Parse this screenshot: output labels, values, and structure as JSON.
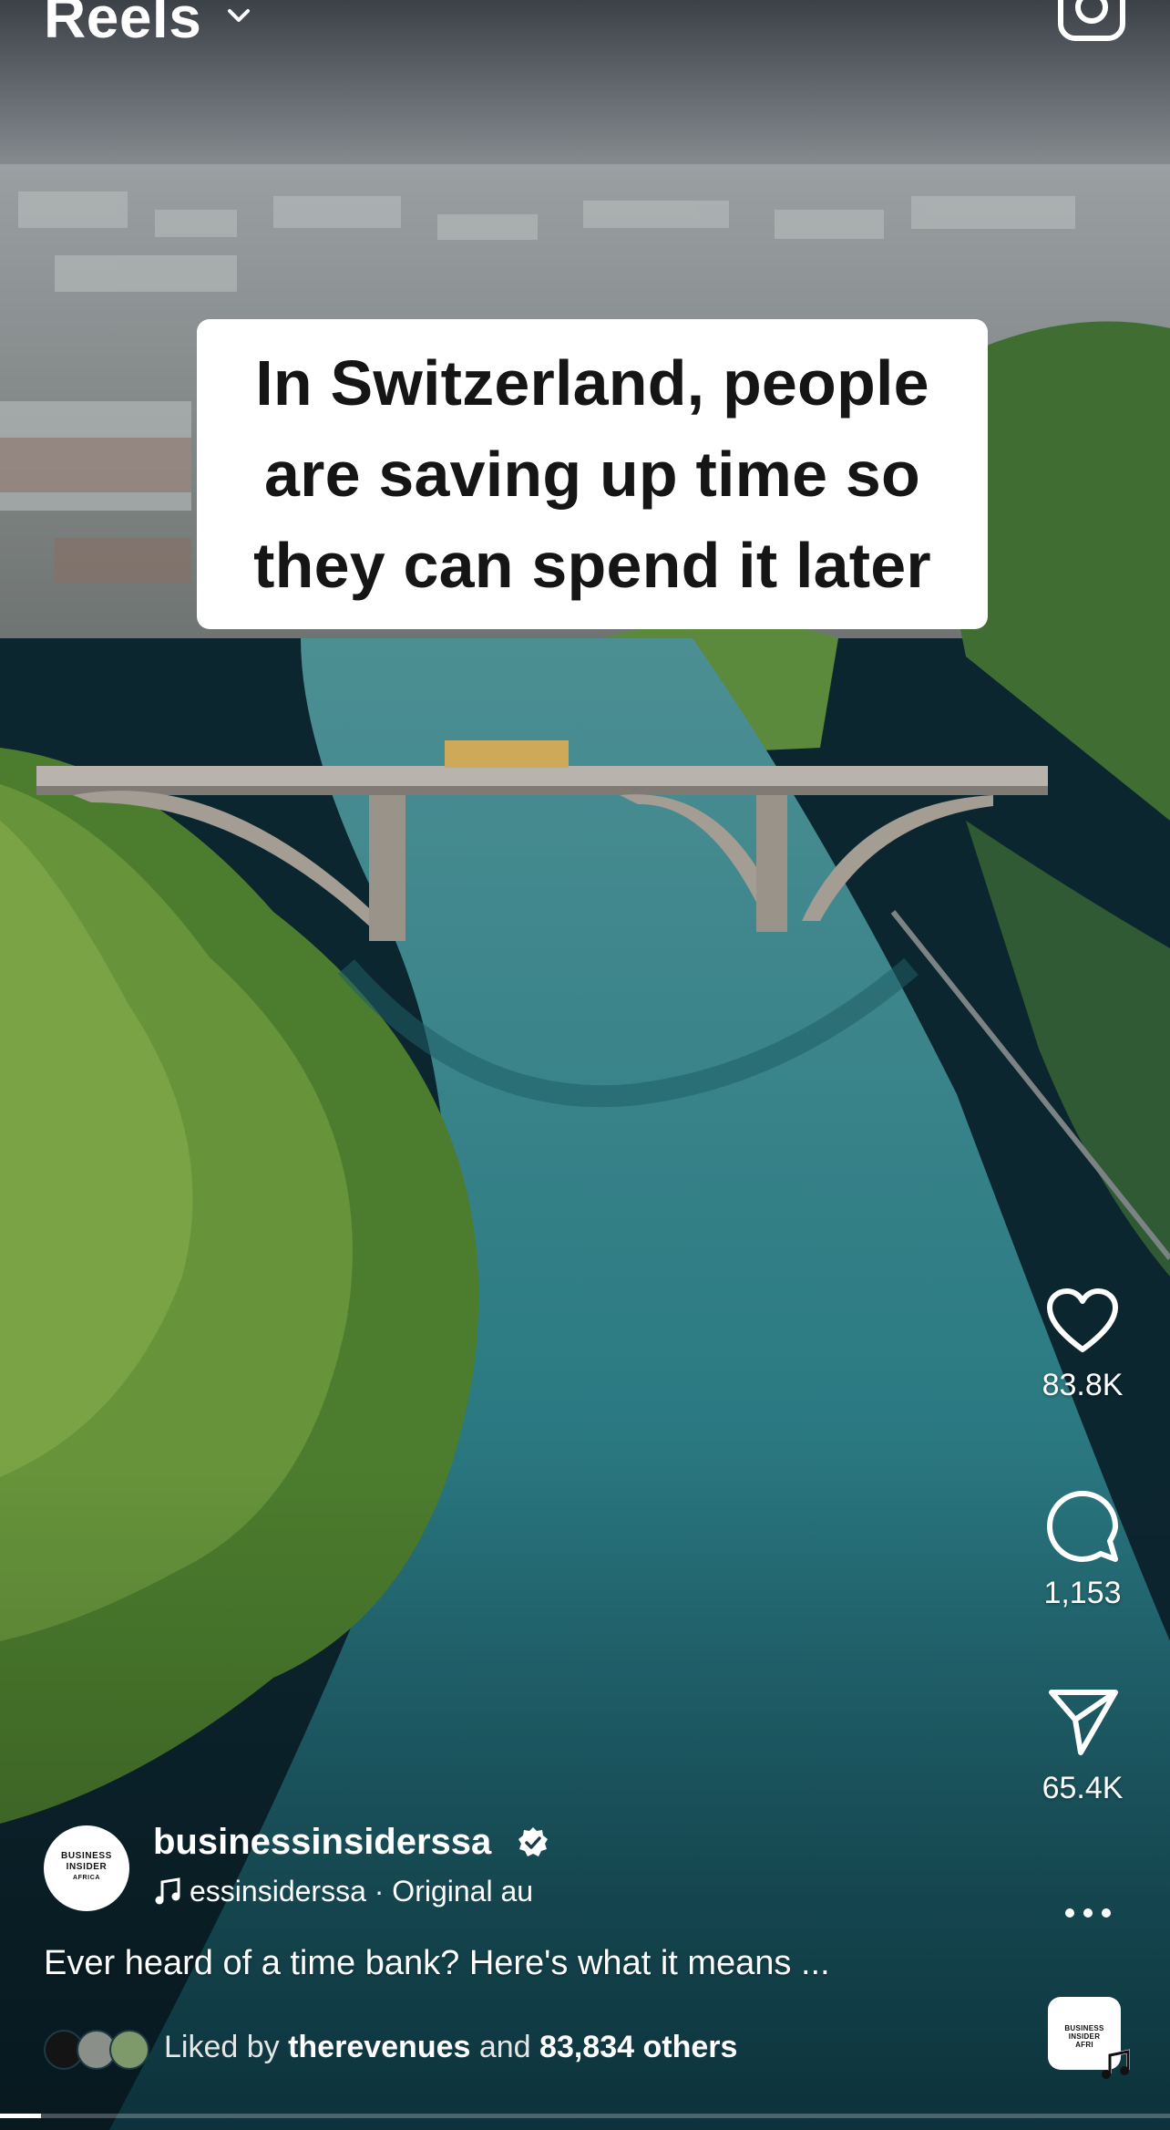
{
  "header": {
    "title": "Reels",
    "title_dropdown_icon": "chevron-down-icon",
    "camera_icon": "camera-icon"
  },
  "video": {
    "caption_lines": [
      "In Switzerland, people",
      "are saving up time so",
      "they can spend it later"
    ],
    "progress_fraction": 0.035
  },
  "actions": {
    "like": {
      "icon": "heart-icon",
      "count": "83.8K"
    },
    "comment": {
      "icon": "comment-bubble-icon",
      "count": "1,153"
    },
    "share": {
      "icon": "paper-plane-icon",
      "count": "65.4K"
    },
    "more_icon": "more-dots-icon"
  },
  "author": {
    "username": "businessinsiderssa",
    "verified_icon": "verified-badge-icon",
    "avatar_text": [
      "BUSINESS",
      "INSIDER",
      "AFRICA"
    ],
    "audio_text": "essinsiderssa · Original au"
  },
  "post": {
    "description": "Ever heard of a time bank? Here's what it means ...",
    "likes_prefix": "Liked by ",
    "likes_user": "therevenues",
    "likes_middle": " and ",
    "likes_others": "83,834 others"
  },
  "audio_thumbnail": {
    "text": [
      "BUSINESS",
      "INSIDER",
      "AFRI"
    ]
  },
  "colors": {
    "river": "#2e7f86",
    "trees": "#4a7a2e",
    "text": "#ffffff",
    "card": "#ffffff"
  }
}
